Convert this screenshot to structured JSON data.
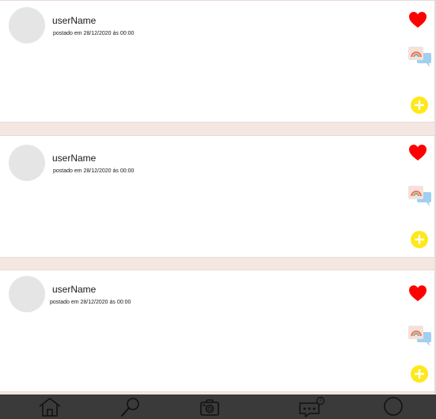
{
  "posts": [
    {
      "username": "userName",
      "posted": "postado em 28/12/2020 ás 00:00"
    },
    {
      "username": "userName",
      "posted": "postado em 28/12/2020 ás 00:00"
    },
    {
      "username": "userName",
      "posted": "postado em 28/12/2020 ás 00:00"
    }
  ],
  "icons": {
    "like": "heart-icon",
    "comments": "comment-bubbles-icon",
    "add": "plus-circle-icon"
  },
  "colors": {
    "heart": "#ff0000",
    "add": "#ffe81a",
    "nav_bg": "#3a3a3a",
    "avatar": "#e5e5e5"
  },
  "bottom_nav": {
    "items": [
      {
        "icon": "home-icon"
      },
      {
        "icon": "search-icon"
      },
      {
        "icon": "camera-icon"
      },
      {
        "icon": "chat-notification-icon",
        "badge": "1"
      },
      {
        "icon": "profile-circle-icon"
      }
    ]
  }
}
